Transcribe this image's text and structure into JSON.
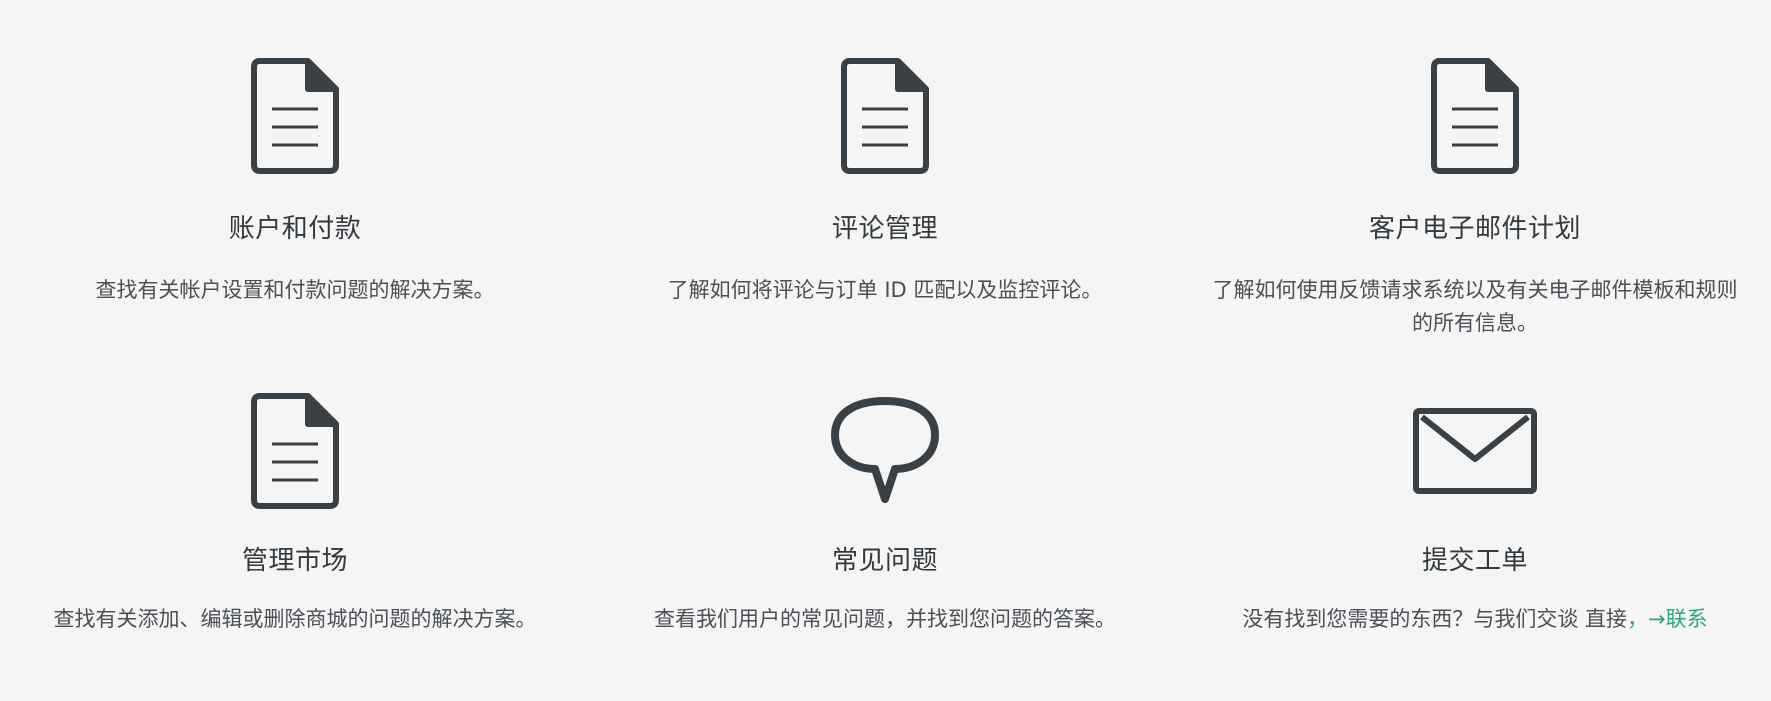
{
  "cards": [
    {
      "icon": "document-icon",
      "title": "账户和付款",
      "description": "查找有关帐户设置和付款问题的解决方案。"
    },
    {
      "icon": "document-icon",
      "title": "评论管理",
      "description": "了解如何将评论与订单 ID 匹配以及监控评论。"
    },
    {
      "icon": "document-icon",
      "title": "客户电子邮件计划",
      "description": "了解如何使用反馈请求系统以及有关电子邮件模板和规则的所有信息。"
    },
    {
      "icon": "document-icon",
      "title": "管理市场",
      "description": "查找有关添加、编辑或删除商城的问题的解决方案。"
    },
    {
      "icon": "speech-bubble-icon",
      "title": "常见问题",
      "description": "查看我们用户的常见问题，并找到您问题的答案。"
    },
    {
      "icon": "envelope-icon",
      "title": "提交工单",
      "description": "没有找到您需要的东西？与我们交谈 直接",
      "link_label": "，→联系"
    }
  ],
  "colors": {
    "background": "#f5f5f5",
    "icon": "#3a4146",
    "text": "#333a3f",
    "link": "#2aa87b"
  }
}
